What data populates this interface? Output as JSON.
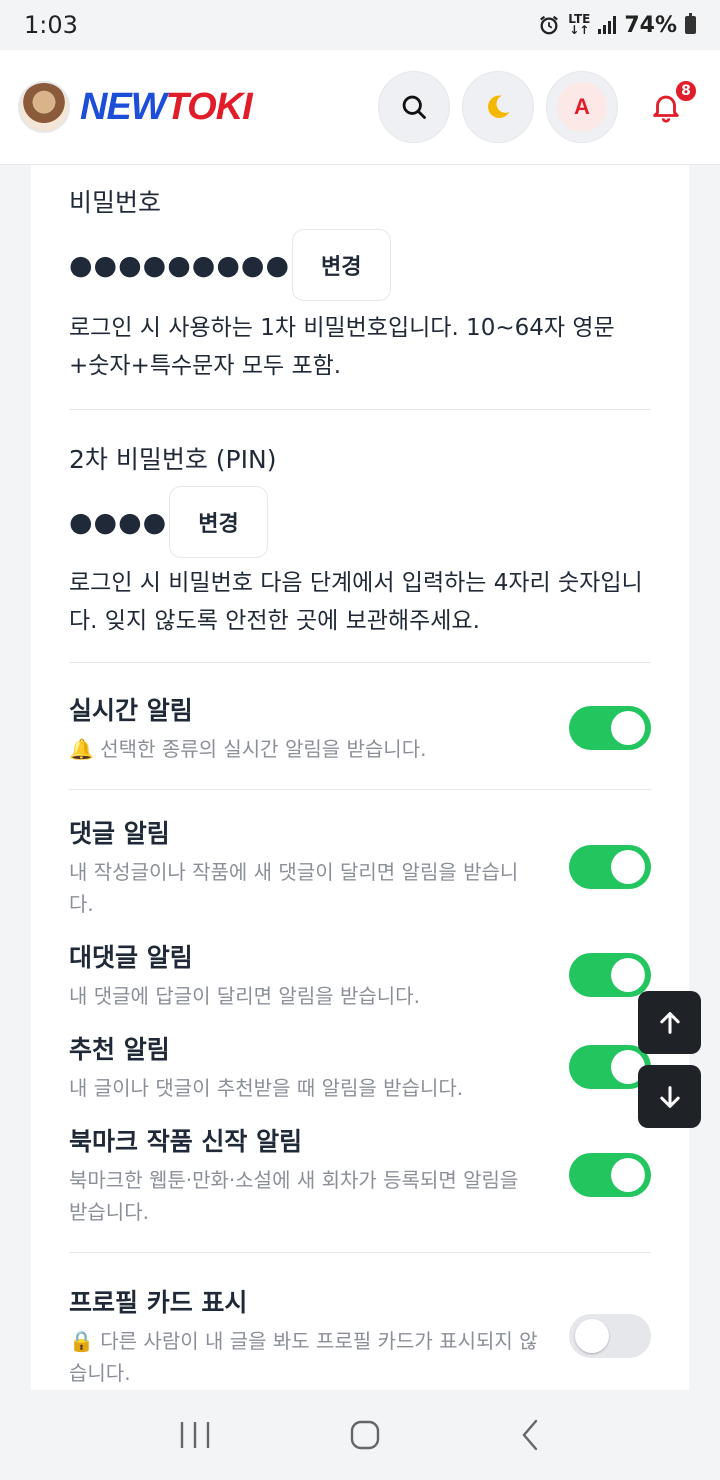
{
  "status": {
    "time": "1:03",
    "network": "LTE",
    "battery": "74%"
  },
  "header": {
    "logo_part1": "NEW",
    "logo_part2": "TOKI",
    "avatar_letter": "A",
    "notification_count": "8"
  },
  "password": {
    "label": "비밀번호",
    "masked": "●●●●●●●●●",
    "change_label": "변경",
    "description": "로그인 시 사용하는 1차 비밀번호입니다. 10~64자 영문+숫자+특수문자 모두 포함."
  },
  "pin": {
    "label": "2차 비밀번호 (PIN)",
    "masked": "●●●●",
    "change_label": "변경",
    "description": "로그인 시 비밀번호 다음 단계에서 입력하는 4자리 숫자입니다. 잊지 않도록 안전한 곳에 보관해주세요."
  },
  "settings": {
    "realtime": {
      "title": "실시간 알림",
      "emoji": "🔔",
      "desc": "선택한 종류의 실시간 알림을 받습니다.",
      "enabled": true
    },
    "comment": {
      "title": "댓글 알림",
      "desc": "내 작성글이나 작품에 새 댓글이 달리면 알림을 받습니다.",
      "enabled": true
    },
    "reply": {
      "title": "대댓글 알림",
      "desc": "내 댓글에 답글이 달리면 알림을 받습니다.",
      "enabled": true
    },
    "recommend": {
      "title": "추천 알림",
      "desc": "내 글이나 댓글이 추천받을 때 알림을 받습니다.",
      "enabled": true
    },
    "bookmark": {
      "title": "북마크 작품 신작 알림",
      "desc": "북마크한 웹툰·만화·소설에 새 회차가 등록되면 알림을 받습니다.",
      "enabled": true
    },
    "profile_card": {
      "title": "프로필 카드 표시",
      "emoji": "🔒",
      "desc": "다른 사람이 내 글을 봐도 프로필 카드가 표시되지 않습니다.",
      "enabled": false
    }
  },
  "colors": {
    "toggle_on": "#22c55e",
    "toggle_off": "#e5e7eb",
    "brand_blue": "#1d4ed8",
    "brand_red": "#e11d2a"
  }
}
